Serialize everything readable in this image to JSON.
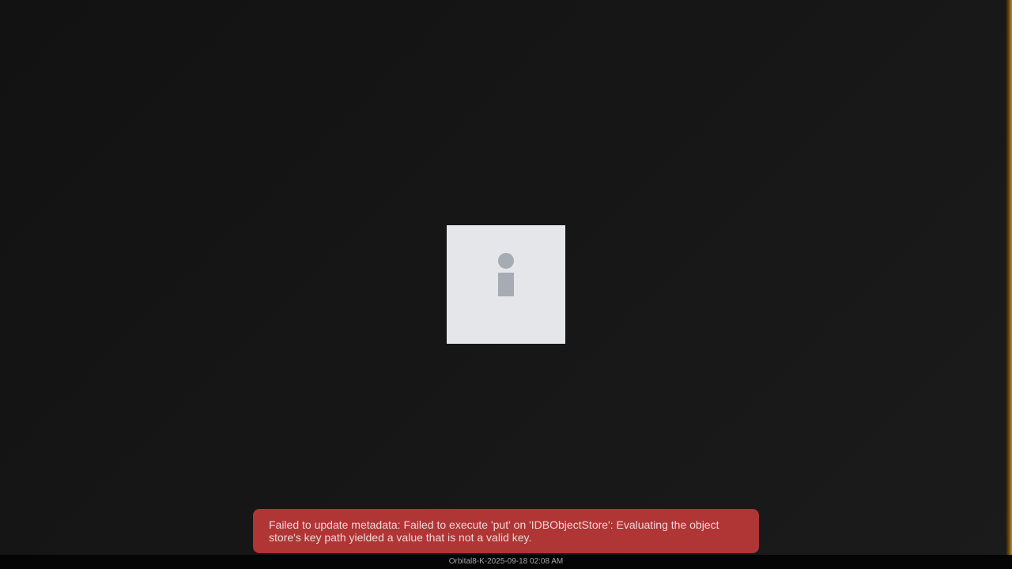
{
  "preview": {
    "icon": "info-icon",
    "icon_color": "#a6abb4",
    "tile_color": "#e4e6ea"
  },
  "toast": {
    "message": "Failed to update metadata: Failed to execute 'put' on 'IDBObjectStore': Evaluating the object store's key path yielded a value that is not a valid key.",
    "background_color": "#b03535"
  },
  "status_bar": {
    "label": "Orbital8-K-2025-09-18 02:08 AM"
  },
  "colors": {
    "background": "#151515",
    "accent_edge": "#c48a1d"
  }
}
